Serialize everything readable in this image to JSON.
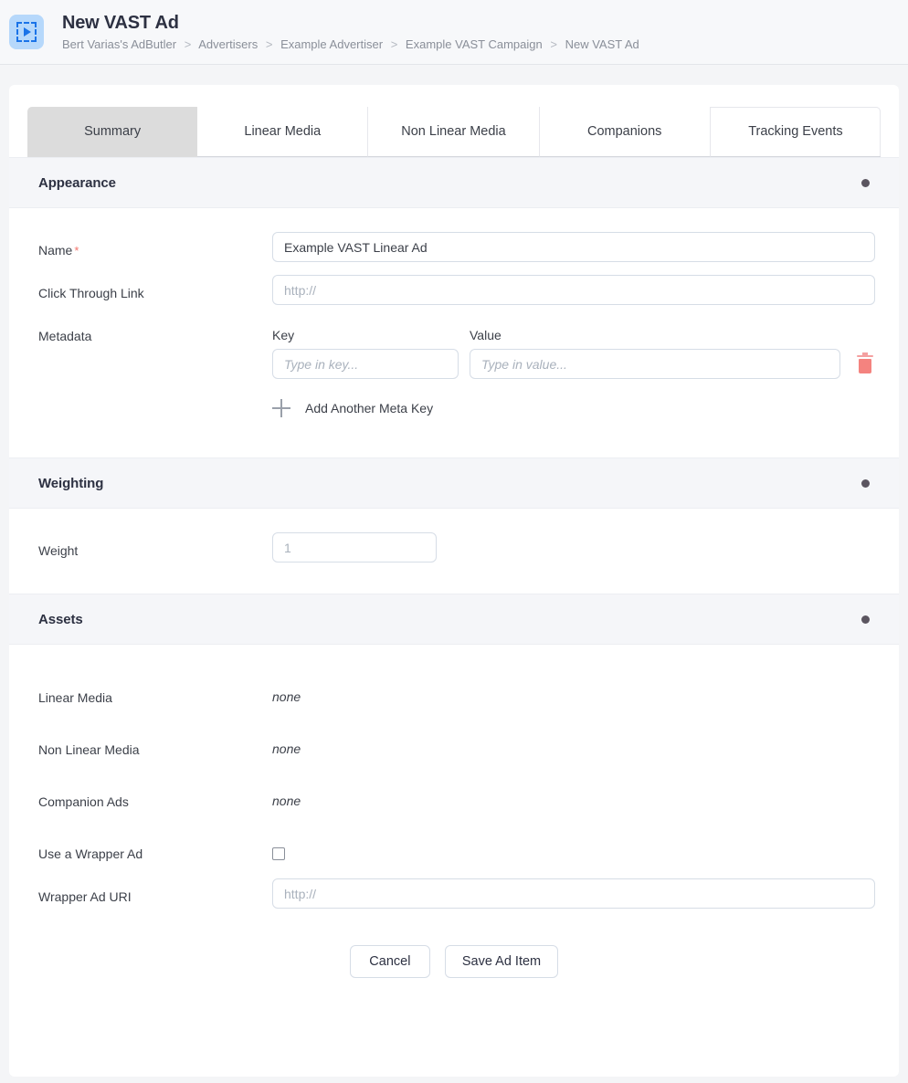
{
  "header": {
    "icon": "vast-video-ad-icon",
    "title": "New VAST Ad",
    "breadcrumb": [
      "Bert Varias's AdButler",
      "Advertisers",
      "Example Advertiser",
      "Example VAST Campaign",
      "New VAST Ad"
    ],
    "breadcrumb_separator": ">"
  },
  "tabs": [
    {
      "label": "Summary",
      "active": true
    },
    {
      "label": "Linear Media",
      "active": false
    },
    {
      "label": "Non Linear Media",
      "active": false
    },
    {
      "label": "Companions",
      "active": false
    },
    {
      "label": "Tracking Events",
      "active": false
    }
  ],
  "sections": {
    "appearance": {
      "title": "Appearance",
      "name": {
        "label": "Name",
        "required_marker": "*",
        "value": "Example VAST Linear Ad"
      },
      "click_through": {
        "label": "Click Through Link",
        "value": "",
        "placeholder": "http://"
      },
      "metadata": {
        "label": "Metadata",
        "key_header": "Key",
        "value_header": "Value",
        "key_value": "",
        "key_placeholder": "Type in key...",
        "value_value": "",
        "value_placeholder": "Type in value...",
        "delete_icon": "trash-icon",
        "add_label": "Add Another Meta Key",
        "add_icon": "plus-icon"
      }
    },
    "weighting": {
      "title": "Weighting",
      "weight": {
        "label": "Weight",
        "value": "",
        "placeholder": "1"
      }
    },
    "assets": {
      "title": "Assets",
      "items": [
        {
          "label": "Linear Media",
          "value": "none"
        },
        {
          "label": "Non Linear Media",
          "value": "none"
        },
        {
          "label": "Companion Ads",
          "value": "none"
        }
      ],
      "wrapper_toggle": {
        "label": "Use a Wrapper Ad",
        "checked": false
      },
      "wrapper_uri": {
        "label": "Wrapper Ad URI",
        "value": "",
        "placeholder": "http://"
      }
    }
  },
  "footer": {
    "cancel_label": "Cancel",
    "save_label": "Save Ad Item"
  },
  "colors": {
    "page_bg": "#f4f5f7",
    "card_bg": "#ffffff",
    "section_band": "#f5f6f9",
    "active_tab": "#dcdcdc",
    "accent_blue": "#1a73e8",
    "icon_bg": "#b6d8fb",
    "required_red": "#f4756c",
    "delete_red": "#f4837f",
    "text_primary": "#2d3142",
    "text_secondary": "#8a8f99"
  }
}
